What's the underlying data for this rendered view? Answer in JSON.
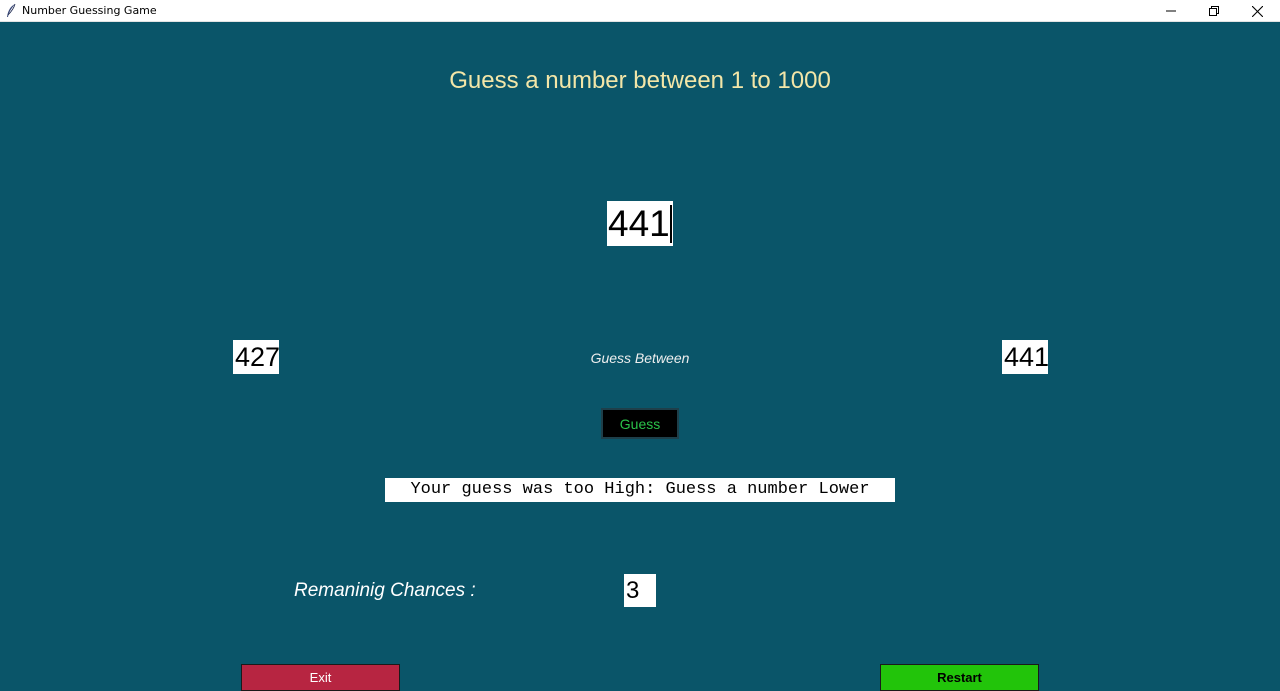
{
  "window": {
    "title": "Number Guessing Game",
    "icon": "feather-icon",
    "controls": [
      "minimize-icon",
      "restore-icon",
      "close-icon"
    ]
  },
  "game": {
    "heading": "Guess a number between 1 to 1000",
    "guess_input_value": "441",
    "range_low": "427",
    "range_label": "Guess Between",
    "range_high": "441",
    "guess_button_label": "Guess",
    "result_message": "Your guess was too High: Guess a number Lower",
    "chances_label": "Remaninig Chances :",
    "chances_value": "3",
    "exit_button_label": "Exit",
    "restart_button_label": "Restart"
  },
  "colors": {
    "background": "#0a5569",
    "heading": "#f3e6a8",
    "guess_button_text": "#2ac24a",
    "exit_button": "#b72541",
    "restart_button": "#22c40a"
  }
}
